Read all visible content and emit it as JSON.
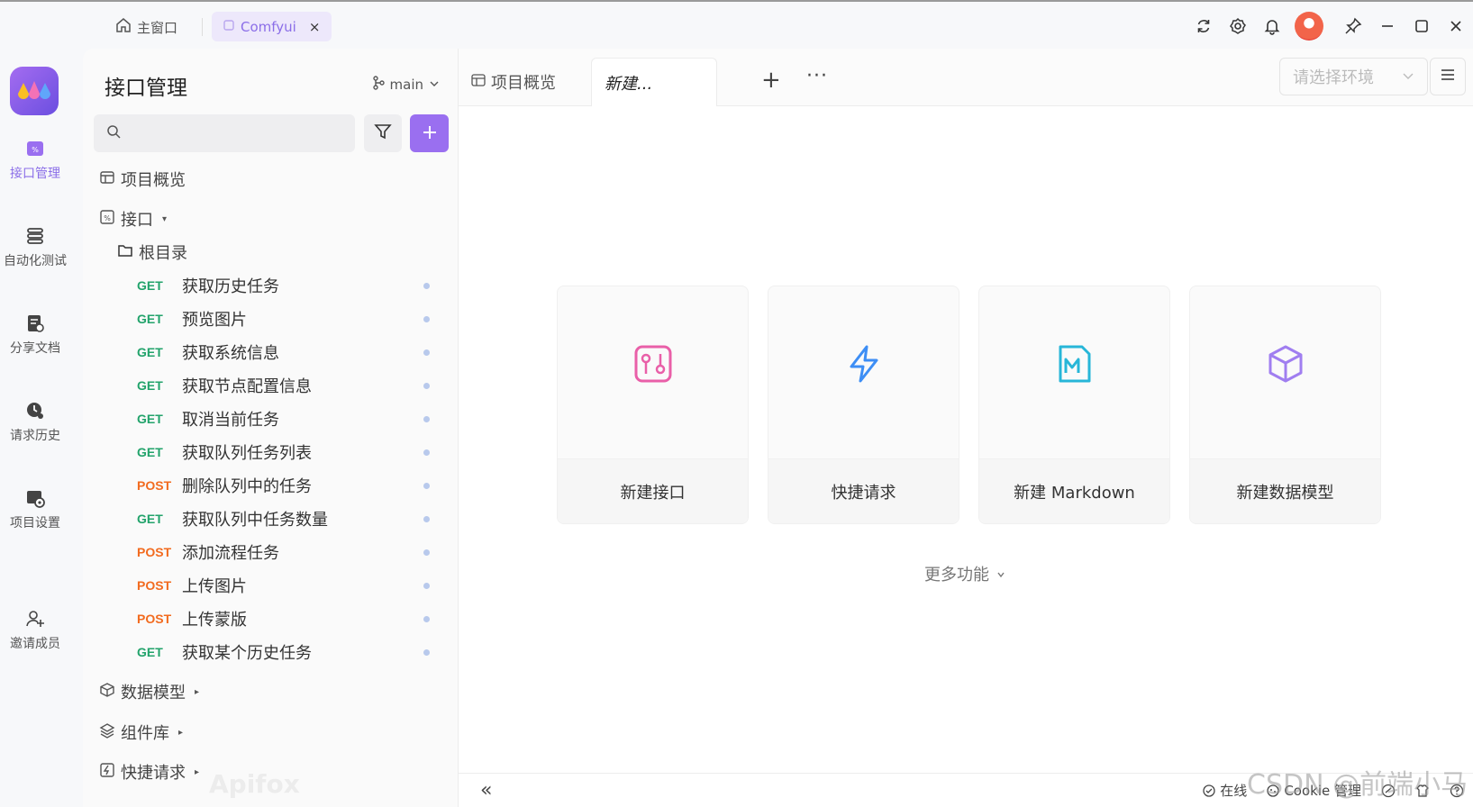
{
  "titlebar": {
    "home_tab": "主窗口",
    "active_tab": "Comfyui",
    "close_glyph": "×"
  },
  "rail": {
    "items": [
      {
        "label": "接口管理",
        "icon": "api-icon",
        "active": true
      },
      {
        "label": "自动化测试",
        "icon": "automation-icon"
      },
      {
        "label": "分享文档",
        "icon": "share-doc-icon"
      },
      {
        "label": "请求历史",
        "icon": "history-icon"
      },
      {
        "label": "项目设置",
        "icon": "settings-icon"
      },
      {
        "label": "邀请成员",
        "icon": "invite-icon"
      }
    ]
  },
  "sidebar": {
    "title": "接口管理",
    "branch": "main",
    "search_placeholder": "",
    "tree": {
      "overview": "项目概览",
      "interfaces": "接口",
      "root": "根目录",
      "data_models": "数据模型",
      "components": "组件库",
      "quick_requests": "快捷请求"
    },
    "apis": [
      {
        "method": "GET",
        "name": "获取历史任务"
      },
      {
        "method": "GET",
        "name": "预览图片"
      },
      {
        "method": "GET",
        "name": "获取系统信息"
      },
      {
        "method": "GET",
        "name": "获取节点配置信息"
      },
      {
        "method": "GET",
        "name": "取消当前任务"
      },
      {
        "method": "GET",
        "name": "获取队列任务列表"
      },
      {
        "method": "POST",
        "name": "删除队列中的任务"
      },
      {
        "method": "GET",
        "name": "获取队列中任务数量"
      },
      {
        "method": "POST",
        "name": "添加流程任务"
      },
      {
        "method": "POST",
        "name": "上传图片"
      },
      {
        "method": "POST",
        "name": "上传蒙版"
      },
      {
        "method": "GET",
        "name": "获取某个历史任务"
      }
    ],
    "watermark": "Apifox"
  },
  "main": {
    "tabs": [
      {
        "label": "项目概览"
      },
      {
        "label": "新建..."
      }
    ],
    "add_tab": "+",
    "more_tabs": "···",
    "env_placeholder": "请选择环境",
    "cards": [
      {
        "label": "新建接口",
        "icon": "api-icon",
        "color": "#e95fa8"
      },
      {
        "label": "快捷请求",
        "icon": "lightning-icon",
        "color": "#3d8ef5"
      },
      {
        "label": "新建 Markdown",
        "icon": "markdown-icon",
        "color": "#27b6d8"
      },
      {
        "label": "新建数据模型",
        "icon": "cube-icon",
        "color": "#a07ef0"
      }
    ],
    "more_functions": "更多功能",
    "status": {
      "collapse": "«",
      "online": "在线",
      "cookie": "Cookie 管理"
    }
  },
  "watermark_csdn": "CSDN @前端小马",
  "colors": {
    "accent": "#9a6ff0",
    "get": "#22a36b",
    "post": "#f26b1f"
  }
}
